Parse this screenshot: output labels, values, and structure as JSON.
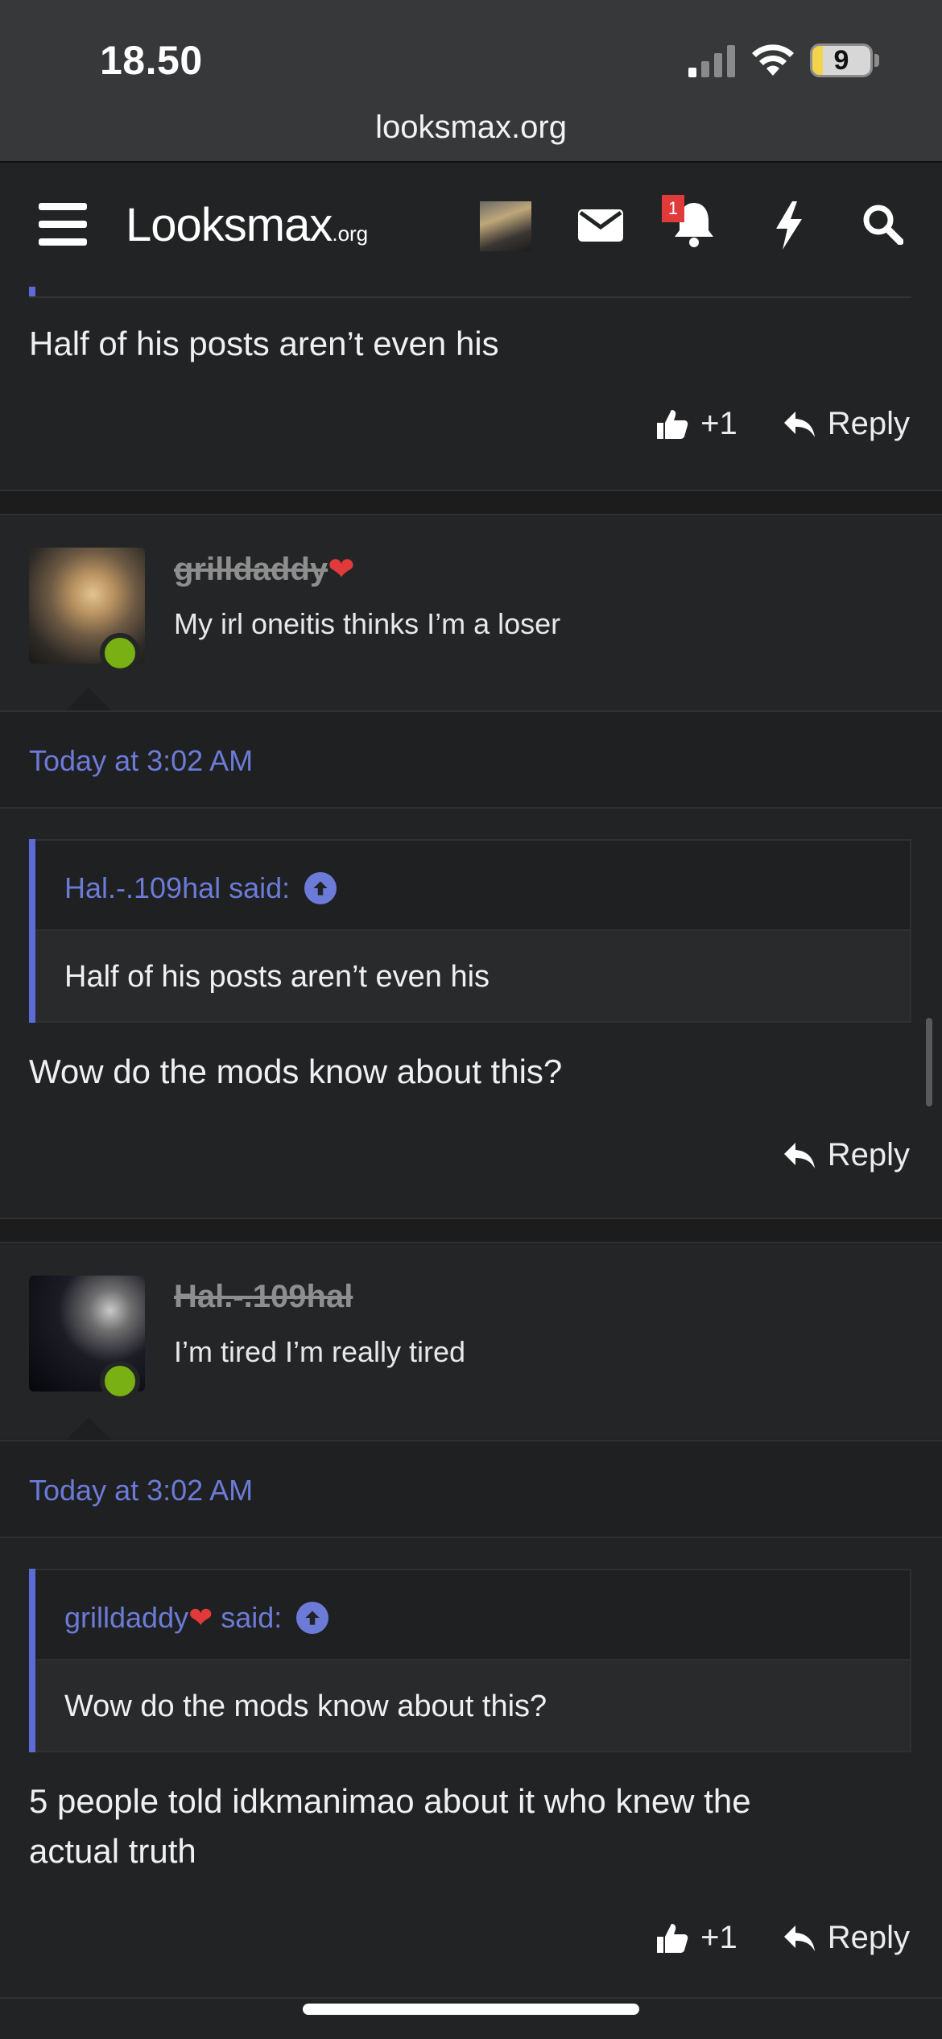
{
  "status_bar": {
    "time": "18.50",
    "battery": "9",
    "url": "looksmax.org"
  },
  "header": {
    "logo_main": "Looksmax",
    "logo_suffix": ".org",
    "notification_count": "1"
  },
  "posts": [
    {
      "text": "Half of his posts aren’t even his",
      "like_label": "+1",
      "reply_label": "Reply"
    },
    {
      "username": "grilldaddy",
      "user_title": "My irl oneitis thinks I’m a loser",
      "date": "Today at 3:02 AM",
      "quote_author": "Hal.-.109hal said:",
      "quote_text": "Half of his posts aren’t even his",
      "text": "Wow do the mods know about this?",
      "reply_label": "Reply"
    },
    {
      "username": "Hal.-.109hal",
      "user_title": "I’m tired I’m really tired",
      "date": "Today at 3:02 AM",
      "quote_author": "grilldaddy",
      "quote_said": " said:",
      "quote_text": "Wow do the mods know about this?",
      "text_line1": "5 people told idkmanimao about it who knew the",
      "text_line2": "actual truth",
      "like_label": "+1",
      "reply_label": "Reply"
    }
  ],
  "colors": {
    "accent": "#6c7bd8",
    "online": "#79b013",
    "heart": "#e23a3a"
  },
  "icons": [
    "signal-icon",
    "wifi-icon",
    "hamburger-icon",
    "mail-icon",
    "bell-icon",
    "bolt-icon",
    "search-icon",
    "thumbs-up-icon",
    "reply-icon",
    "arrow-up-circle-icon",
    "heart-icon"
  ]
}
